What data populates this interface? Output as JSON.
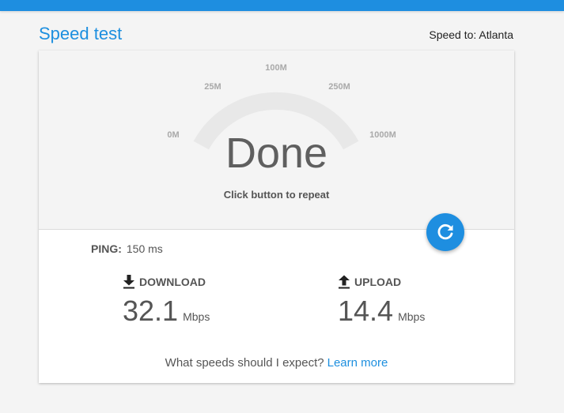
{
  "header": {
    "title": "Speed test",
    "speed_to": "Speed to: Atlanta",
    "accent_color": "#1e8ee0"
  },
  "gauge": {
    "ticks": [
      "0M",
      "25M",
      "100M",
      "250M",
      "1000M"
    ],
    "status": "Done",
    "hint": "Click button to repeat"
  },
  "repeat_button": {
    "icon": "refresh-icon"
  },
  "results": {
    "ping_label": "PING:",
    "ping_value": "150 ms",
    "download": {
      "label": "DOWNLOAD",
      "value": "32.1",
      "unit": "Mbps",
      "icon": "download-icon"
    },
    "upload": {
      "label": "UPLOAD",
      "value": "14.4",
      "unit": "Mbps",
      "icon": "upload-icon"
    }
  },
  "footer": {
    "question": "What speeds should I expect?",
    "link": "Learn more"
  }
}
